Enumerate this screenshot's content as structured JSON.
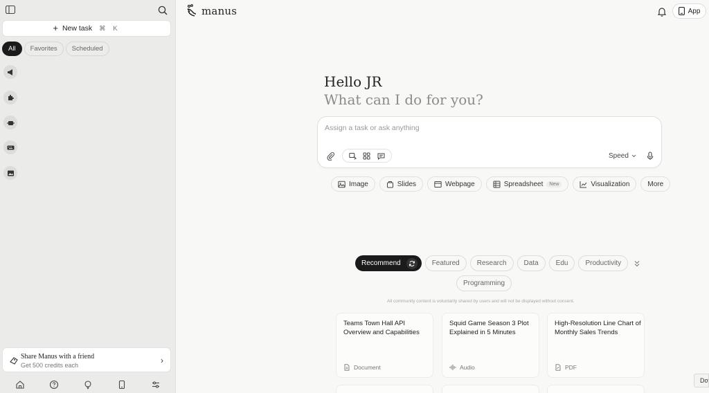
{
  "sidebar": {
    "new_task_label": "New task",
    "new_task_shortcut": "⌘ K",
    "filters": [
      "All",
      "Favorites",
      "Scheduled"
    ],
    "share": {
      "title": "Share Manus with a friend",
      "subtitle": "Get 500 credits each"
    }
  },
  "header": {
    "logo_text": "manus",
    "app_button_label": "App"
  },
  "greeting": {
    "hello": "Hello JR",
    "question": "What can I do for you?"
  },
  "composer": {
    "placeholder": "Assign a task or ask anything",
    "mode_label": "Speed"
  },
  "quick_actions": [
    {
      "label": "Image",
      "icon": "image-icon"
    },
    {
      "label": "Slides",
      "icon": "slides-icon"
    },
    {
      "label": "Webpage",
      "icon": "webpage-icon"
    },
    {
      "label": "Spreadsheet",
      "icon": "spreadsheet-icon",
      "badge": "New"
    },
    {
      "label": "Visualization",
      "icon": "chart-icon"
    },
    {
      "label": "More",
      "icon": ""
    }
  ],
  "categories": [
    "Recommend",
    "Featured",
    "Research",
    "Data",
    "Edu",
    "Productivity",
    "Programming"
  ],
  "disclaimer": "All community content is voluntarily shared by users and will not be displayed without consent.",
  "cards": [
    {
      "title": "Teams Town Hall API Overview and Capabilities",
      "type": "Document"
    },
    {
      "title": "Squid Game Season 3 Plot Explained in 5 Minutes",
      "type": "Audio"
    },
    {
      "title": "High-Resolution Line Chart of Monthly Sales Trends",
      "type": "PDF"
    }
  ],
  "floating_button": "Dow"
}
